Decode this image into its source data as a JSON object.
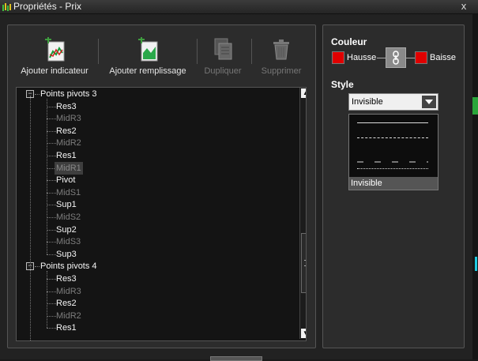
{
  "window": {
    "title": "Propriétés - Prix",
    "close_label": "x"
  },
  "toolbar": {
    "add_indicator": "Ajouter indicateur",
    "add_fill": "Ajouter remplissage",
    "duplicate": "Dupliquer",
    "delete": "Supprimer"
  },
  "tree": {
    "groups": [
      {
        "label": "Points pivots 3",
        "items": [
          {
            "label": "Res3",
            "active": true
          },
          {
            "label": "MidR3",
            "active": false
          },
          {
            "label": "Res2",
            "active": true
          },
          {
            "label": "MidR2",
            "active": false
          },
          {
            "label": "Res1",
            "active": true
          },
          {
            "label": "MidR1",
            "active": false,
            "selected": true
          },
          {
            "label": "Pivot",
            "active": true
          },
          {
            "label": "MidS1",
            "active": false
          },
          {
            "label": "Sup1",
            "active": true
          },
          {
            "label": "MidS2",
            "active": false
          },
          {
            "label": "Sup2",
            "active": true
          },
          {
            "label": "MidS3",
            "active": false
          },
          {
            "label": "Sup3",
            "active": true
          }
        ]
      },
      {
        "label": "Points pivots 4",
        "items": [
          {
            "label": "Res3",
            "active": true
          },
          {
            "label": "MidR3",
            "active": false
          },
          {
            "label": "Res2",
            "active": true
          },
          {
            "label": "MidR2",
            "active": false
          },
          {
            "label": "Res1",
            "active": true
          }
        ]
      }
    ]
  },
  "color": {
    "title": "Couleur",
    "up_label": "Hausse",
    "down_label": "Baisse",
    "up_color": "#e00000",
    "down_color": "#e00000"
  },
  "style": {
    "title": "Style",
    "selected": "Invisible",
    "options": [
      "solid",
      "dashed",
      "dash-dot",
      "dotted",
      "Invisible"
    ]
  }
}
